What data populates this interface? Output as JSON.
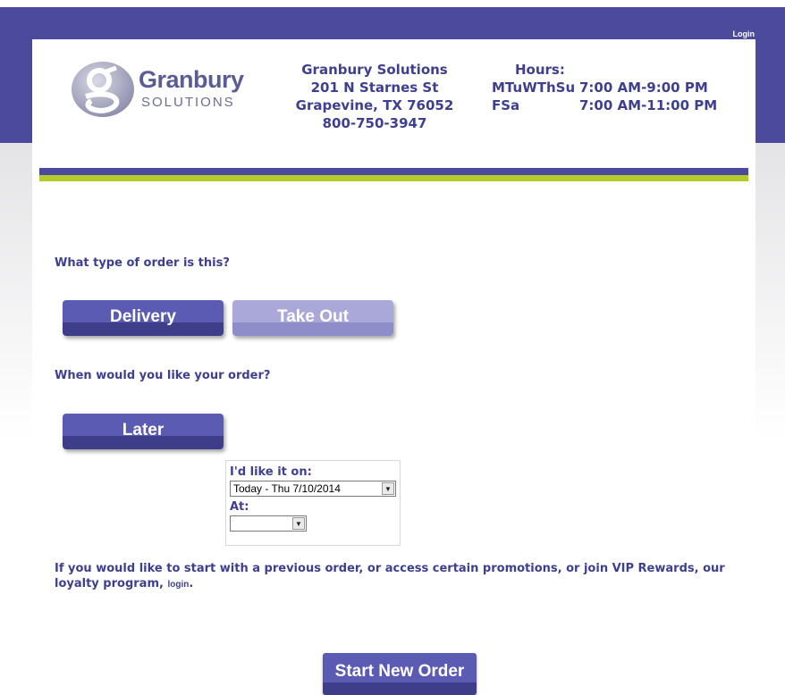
{
  "header": {
    "login_label": "Login",
    "logo_word": "Granbury",
    "logo_sub": "SOLUTIONS",
    "address": {
      "name": "Granbury Solutions",
      "street": "201 N Starnes St",
      "city": "Grapevine, TX 76052",
      "phone": "800-750-3947"
    },
    "hours": {
      "title": "Hours:",
      "rows": [
        {
          "days": "MTuWThSu",
          "time": "7:00 AM-9:00 PM"
        },
        {
          "days": "FSa",
          "time": "7:00 AM-11:00 PM"
        }
      ]
    }
  },
  "order": {
    "type_question": "What type of order is this?",
    "delivery_label": "Delivery",
    "takeout_label": "Take Out",
    "when_question": "When would you like your order?",
    "later_label": "Later",
    "schedule": {
      "date_label": "I'd like it on:",
      "date_value": "Today - Thu 7/10/2014",
      "time_label": "At:",
      "time_value": ""
    },
    "info_text": "If you would like to start with a previous order, or access certain promotions, or join VIP Rewards, our loyalty program,",
    "info_link": "login",
    "start_label": "Start New Order"
  },
  "colors": {
    "brand_purple": "#4b4a9c",
    "accent_green": "#b3cc2c",
    "button_purple": "#5c5bb4",
    "button_light": "#a9a8d9"
  }
}
